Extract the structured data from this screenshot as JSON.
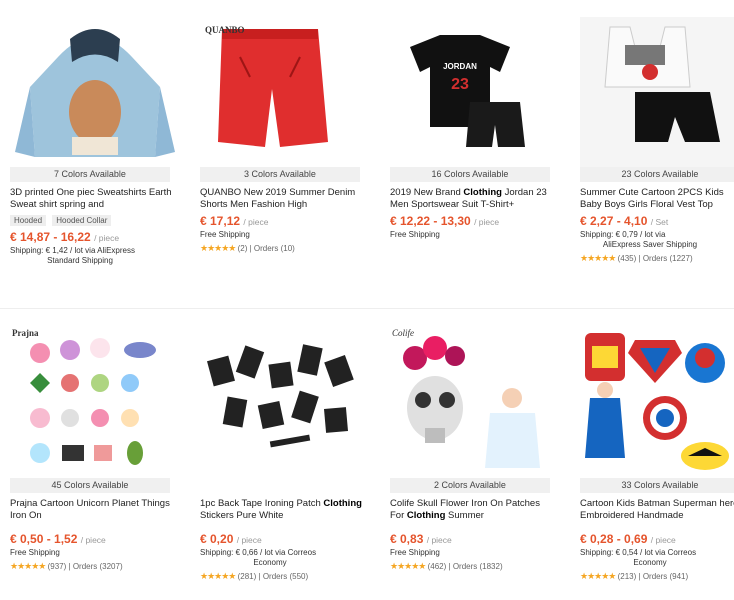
{
  "products": [
    {
      "colors": "7 Colors Available",
      "title": "3D printed One piec Sweatshirts Earth Sweat shirt spring and",
      "tags": [
        "Hooded",
        "Hooded Collar"
      ],
      "price": "€ 14,87 - 16,22",
      "unit": "/ piece",
      "shipping": "Shipping: € 1,42 / lot via AliExpress",
      "shipping_sub": "Standard Shipping",
      "rating_count": "",
      "orders": ""
    },
    {
      "colors": "3 Colors Available",
      "title": "QUANBO New 2019 Summer Denim Shorts Men Fashion High",
      "price": "€ 17,12",
      "unit": "/ piece",
      "shipping": "Free Shipping",
      "rating_count": "(2)",
      "orders": "Orders (10)",
      "brand": "QUANBO"
    },
    {
      "colors": "16 Colors Available",
      "title_pre": "2019 New Brand ",
      "title_bold": "Clothing",
      "title_post": " Jordan 23 Men Sportswear Suit T-Shirt+",
      "price": "€ 12,22 - 13,30",
      "unit": "/ piece",
      "shipping": "Free Shipping",
      "shirt_text": "JORDAN",
      "shirt_num": "23"
    },
    {
      "colors": "23 Colors Available",
      "title": "Summer Cute Cartoon 2PCS Kids Baby Boys Girls Floral Vest Top",
      "price": "€ 2,27 - 4,10",
      "unit": "/ Set",
      "shipping": "Shipping: € 0,79 / lot via",
      "shipping_sub": "AliExpress Saver Shipping",
      "rating_count": "(435)",
      "orders": "Orders (1227)"
    },
    {
      "colors": "45 Colors Available",
      "title": "Prajna Cartoon Unicorn Planet Things Iron On",
      "price": "€ 0,50 - 1,52",
      "unit": "/ piece",
      "shipping": "Free Shipping",
      "rating_count": "(937)",
      "orders": "Orders (3207)",
      "brand": "Prajna"
    },
    {
      "colors": "",
      "title_pre": "1pc Back Tape Ironing Patch ",
      "title_bold": "Clothing",
      "title_post": " Stickers Pure White",
      "price": "€ 0,20",
      "unit": "/ piece",
      "shipping": "Shipping: € 0,66 / lot via Correos",
      "shipping_sub": "Economy",
      "rating_count": "(281)",
      "orders": "Orders (550)"
    },
    {
      "colors": "2 Colors Available",
      "title_pre": "Colife Skull Flower Iron On Patches For ",
      "title_bold": "Clothing",
      "title_post": " Summer",
      "price": "€ 0,83",
      "unit": "/ piece",
      "shipping": "Free Shipping",
      "rating_count": "(462)",
      "orders": "Orders (1832)",
      "brand": "Colife"
    },
    {
      "colors": "33 Colors Available",
      "title": "Cartoon Kids Batman Superman hero Embroidered Handmade",
      "price": "€ 0,28 - 0,69",
      "unit": "/ piece",
      "shipping": "Shipping: € 0,54 / lot via Correos",
      "shipping_sub": "Economy",
      "rating_count": "(213)",
      "orders": "Orders (941)"
    }
  ],
  "stars": "★★★★★",
  "sep": "|",
  "colors_theme": {
    "price": "#e5542c",
    "star": "#f5a623"
  }
}
